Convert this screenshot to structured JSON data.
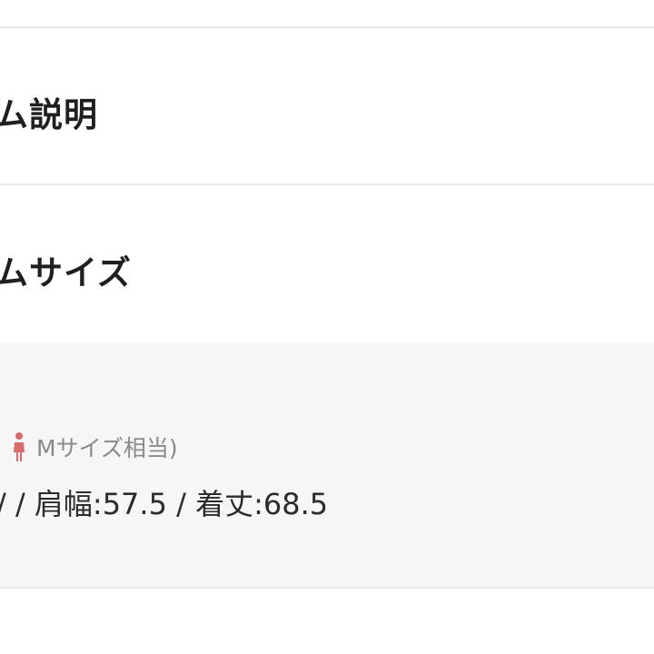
{
  "sections": {
    "description_heading": "ム説明",
    "size_heading": "ムサイズ"
  },
  "size_panel": {
    "note": "Mサイズ相当)",
    "measurements": "/ / 肩幅:57.5 / 着丈:68.5",
    "icon": "female-person-icon",
    "icon_color": "#d96b6b"
  },
  "colors": {
    "background": "#ffffff",
    "panel_background": "#f6f6f6",
    "divider": "#e9e9e9",
    "heading_text": "#1f1f1f",
    "note_text": "#8a8a8a",
    "body_text": "#2b2b2b"
  }
}
